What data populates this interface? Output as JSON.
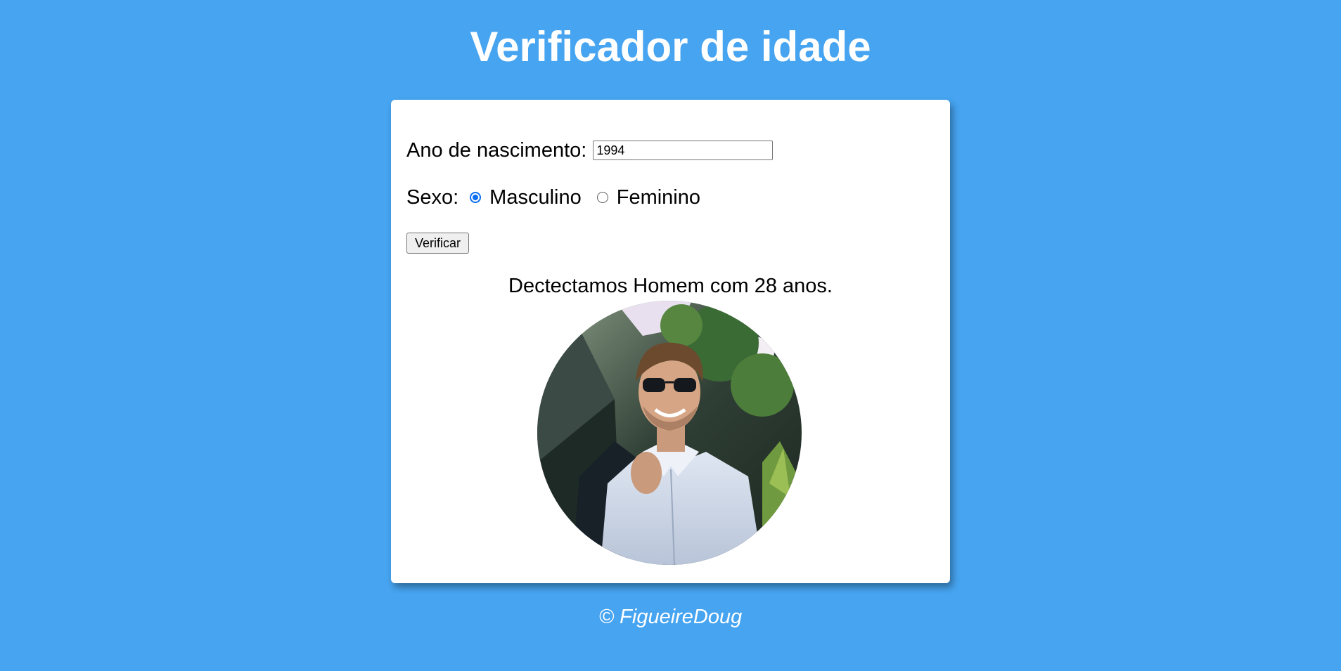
{
  "header": {
    "title": "Verificador de idade"
  },
  "form": {
    "year_label": "Ano de nascimento:",
    "year_value": "1994",
    "sex_label": "Sexo:",
    "sex_options": [
      {
        "label": "Masculino",
        "checked": true
      },
      {
        "label": "Feminino",
        "checked": false
      }
    ],
    "verify_button": "Verificar"
  },
  "result": {
    "text": "Dectectamos Homem com 28 anos.",
    "image_icon": "man-photo"
  },
  "footer": {
    "text": "© FigueireDoug"
  },
  "colors": {
    "background": "#46a4f0",
    "card": "#ffffff",
    "radio_accent": "#0b6ef0"
  }
}
